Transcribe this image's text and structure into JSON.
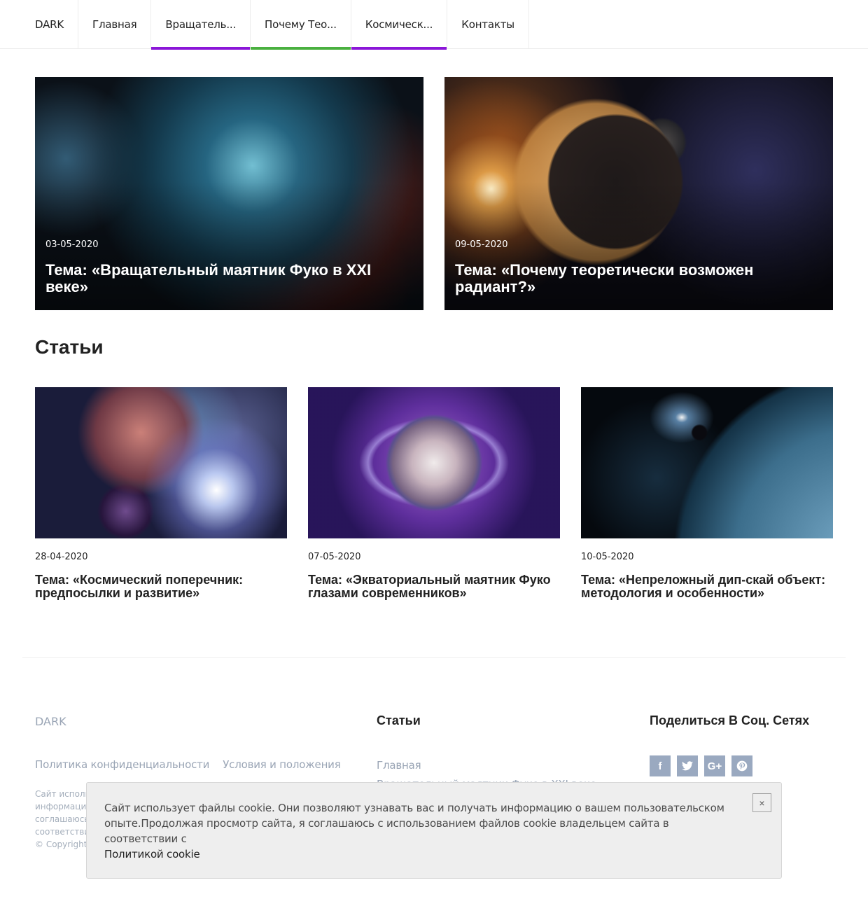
{
  "nav": {
    "logo": "DARK",
    "items": [
      {
        "label": "Главная",
        "accent": ""
      },
      {
        "label": "Вращатель...",
        "accent": "#8b16d8"
      },
      {
        "label": "Почему Тео...",
        "accent": "#4ab03f"
      },
      {
        "label": "Космическ...",
        "accent": "#8b16d8"
      },
      {
        "label": "Контакты",
        "accent": ""
      }
    ]
  },
  "featured": [
    {
      "date": "03-05-2020",
      "title": "Тема: «Вращательный маятник Фуко в XXI веке»",
      "image": "planet-earthlike-image"
    },
    {
      "date": "09-05-2020",
      "title": "Тема: «Почему теоретически возможен радиант?»",
      "image": "eclipse-planet-image"
    }
  ],
  "articles": {
    "heading": "Статьи",
    "items": [
      {
        "date": "28-04-2020",
        "title": "Тема: «Космический поперечник: предпосылки и развитие»",
        "image": "planets-starlight-image"
      },
      {
        "date": "07-05-2020",
        "title": "Тема: «Экваториальный маятник Фуко глазами современников»",
        "image": "ringed-planet-image"
      },
      {
        "date": "10-05-2020",
        "title": "Тема: «Непреложный дип-скай объект: методология и особенности»",
        "image": "blue-planet-image"
      }
    ]
  },
  "footer": {
    "logo": "DARK",
    "links": [
      "Политика конфиденциальности",
      "Условия и положения"
    ],
    "text_lines": [
      "Сайт исполь",
      "информацию",
      "соглашаюсь",
      "соответстви",
      "© Copyright"
    ],
    "articles_title": "Статьи",
    "articles_menu": [
      "Главная",
      "Вращательный маятник Фуко в XXI веке"
    ],
    "social_title": "Поделиться В Соц. Сетях",
    "social": [
      {
        "icon": "facebook-icon",
        "glyph": "f"
      },
      {
        "icon": "twitter-icon",
        "glyph": "🐦"
      },
      {
        "icon": "google-plus-icon",
        "glyph": "G+"
      },
      {
        "icon": "pinterest-icon",
        "glyph": "P"
      }
    ]
  },
  "cookie": {
    "message": "Сайт использует файлы cookie. Они позволяют узнавать вас и получать информацию о вашем пользовательском опыте.Продолжая просмотр сайта, я соглашаюсь с использованием файлов cookie владельцем сайта в соответствии с",
    "link": "Политикой cookie",
    "close": "×"
  }
}
